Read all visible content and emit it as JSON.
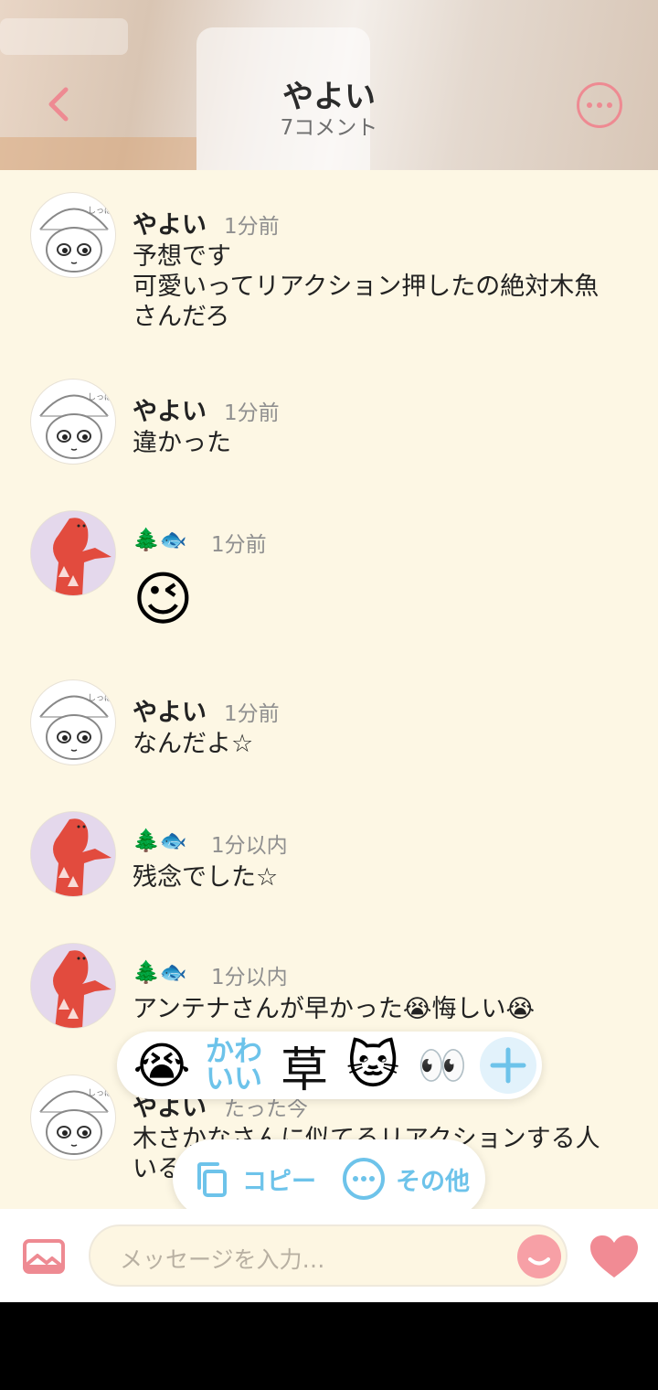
{
  "header": {
    "title": "やよい",
    "subtitle": "7コメント"
  },
  "messages": [
    {
      "name": "やよい",
      "time": "1分前",
      "lines": [
        "予想です",
        "可愛いってリアクション押したの絶対木魚",
        "さんだろ"
      ]
    },
    {
      "name": "やよい",
      "time": "1分前",
      "lines": [
        "違かった"
      ]
    },
    {
      "name": "🌲🐟",
      "time": "1分前",
      "emoji": "😉"
    },
    {
      "name": "やよい",
      "time": "1分前",
      "lines": [
        "なんだよ☆"
      ]
    },
    {
      "name": "🌲🐟",
      "time": "1分以内",
      "lines": [
        "残念でした☆"
      ]
    },
    {
      "name": "🌲🐟",
      "time": "1分以内",
      "lines": [
        "アンテナさんが早かった😭悔しい😭"
      ]
    },
    {
      "name": "やよい",
      "time": "たった今",
      "lines": [
        "木さかなさんに似てるリアクションする人",
        "いる"
      ]
    }
  ],
  "reactions": {
    "crying": "😭",
    "kawaii_line1": "かわ",
    "kawaii_line2": "いい",
    "kusa": "草",
    "cat": "🐱",
    "eyes": "👀"
  },
  "actions": {
    "copy_label": "コピー",
    "other_label": "その他"
  },
  "input": {
    "placeholder": "メッセージを入力…"
  },
  "colors": {
    "accent_pink": "#ee8a92",
    "accent_blue": "#6dc3ea",
    "background": "#fdf7e4"
  }
}
